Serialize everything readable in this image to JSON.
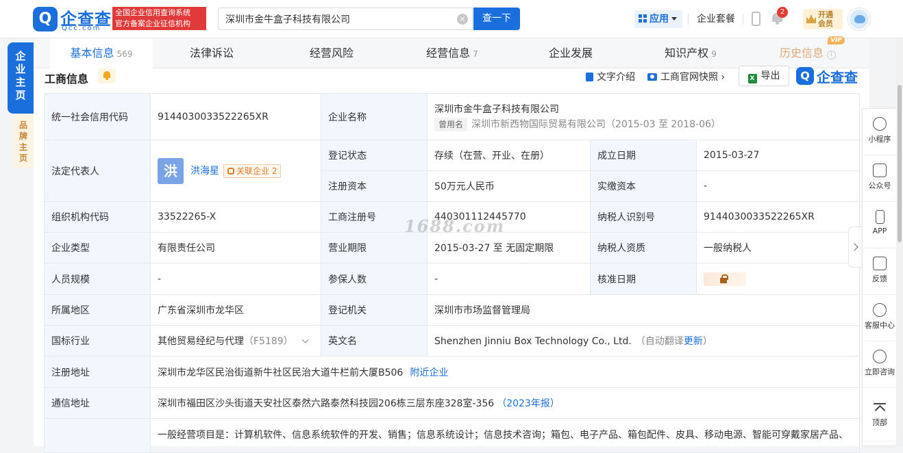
{
  "header": {
    "logo_mark": "Q",
    "logo_cn": "企查查",
    "logo_en": "Qcc.com",
    "slogan_line1": "全国企业信用查询系统",
    "slogan_line2": "官方备案企业征信机构",
    "search_value": "深圳市金牛盒子科技有限公司",
    "search_button": "查一下",
    "app_label": "应用",
    "package_label": "企业套餐",
    "notification_count": "2",
    "vip_line1": "开通",
    "vip_line2": "会员"
  },
  "left_tabs": {
    "main": "企业主页",
    "brand": "品牌主页"
  },
  "tabs": [
    {
      "label": "基本信息",
      "count": "569",
      "active": true
    },
    {
      "label": "法律诉讼",
      "count": ""
    },
    {
      "label": "经营风险",
      "count": ""
    },
    {
      "label": "经营信息",
      "count": "7"
    },
    {
      "label": "企业发展",
      "count": ""
    },
    {
      "label": "知识产权",
      "count": "9"
    },
    {
      "label": "历史信息",
      "count": "",
      "vip": "VIP"
    }
  ],
  "section": {
    "title": "工商信息",
    "text_intro": "文字介绍",
    "snapshot": "工商官网快照",
    "export": "导出",
    "xls": "X",
    "brand_mark": "Q",
    "brand_text": "企查查"
  },
  "company": {
    "credit_code_label": "统一社会信用代码",
    "credit_code": "91440300335222​65XR",
    "name_label": "企业名称",
    "name": "深圳市金牛盒子科技有限公司",
    "former_tag": "曾用名",
    "former_name": "深圳市新西物国际贸易有限公司",
    "former_period": "（2015-03 至 2018-06）",
    "legal_rep_label": "法定代表人",
    "legal_rep_avatar": "洪",
    "legal_rep": "洪海星",
    "related_label": "关联企业",
    "related_count": "2",
    "status_label": "登记状态",
    "status": "存续（在营、开业、在册）",
    "founded_label": "成立日期",
    "founded": "2015-03-27",
    "capital_label": "注册资本",
    "capital": "50万元人民币",
    "paid_capital_label": "实缴资本",
    "paid_capital": "-",
    "org_code_label": "组织机构代码",
    "org_code": "33522265-X",
    "reg_no_label": "工商注册号",
    "reg_no": "440301112445770",
    "taxpayer_id_label": "纳税人识别号",
    "taxpayer_id": "91440300335222​65XR",
    "type_label": "企业类型",
    "type": "有限责任公司",
    "term_label": "营业期限",
    "term": "2015-03-27 至 无固定期限",
    "taxpayer_qual_label": "纳税人资质",
    "taxpayer_qual": "一般纳税人",
    "staff_label": "人员规模",
    "staff": "-",
    "insured_label": "参保人数",
    "insured": "-",
    "approve_label": "核准日期",
    "region_label": "所属地区",
    "region": "广东省深圳市龙华区",
    "authority_label": "登记机关",
    "authority": "深圳市市场监督管理局",
    "industry_label": "国标行业",
    "industry": "其他贸易经纪与代理",
    "industry_code": "（F5189）",
    "en_name_label": "英文名",
    "en_name": "Shenzhen Jinniu Box Technology Co., Ltd.",
    "auto_translate": "（自动翻译",
    "update_link": "更新",
    "close_paren": "）",
    "reg_addr_label": "注册地址",
    "reg_addr": "深圳市龙华区民治街道新牛社区民治大道牛栏前大厦B506",
    "nearby_link": "附近企业",
    "mail_addr_label": "通信地址",
    "mail_addr": "深圳市福田区沙头街道天安社区泰然六路泰然科技园206栋三层东座328室-356",
    "mail_addr_year": "（2023年报）",
    "scope_partial": "一般经营项目是：计算机软件、信息系统软件的开发、销售；信息系统设计；信息技术咨询；箱包、电子产品、箱包配件、皮具、移动电源、智能可穿戴家居产品、"
  },
  "watermark": "1688.com",
  "right_sidebar": [
    {
      "label": "小程序",
      "icon": "mini-program-icon"
    },
    {
      "label": "公众号",
      "icon": "official-account-icon"
    },
    {
      "label": "APP",
      "icon": "phone-icon"
    },
    {
      "label": "反馈",
      "icon": "feedback-icon"
    },
    {
      "label": "客服中心",
      "icon": "headset-icon"
    },
    {
      "label": "立即咨询",
      "icon": "chat-icon"
    },
    {
      "label": "顶部",
      "icon": "back-to-top-icon"
    }
  ],
  "colors": {
    "brand_blue": "#1a6fdc",
    "label_bg": "#f2f7fe",
    "slogan_red": "#e03a3a",
    "vip_gold": "#d8a441"
  }
}
